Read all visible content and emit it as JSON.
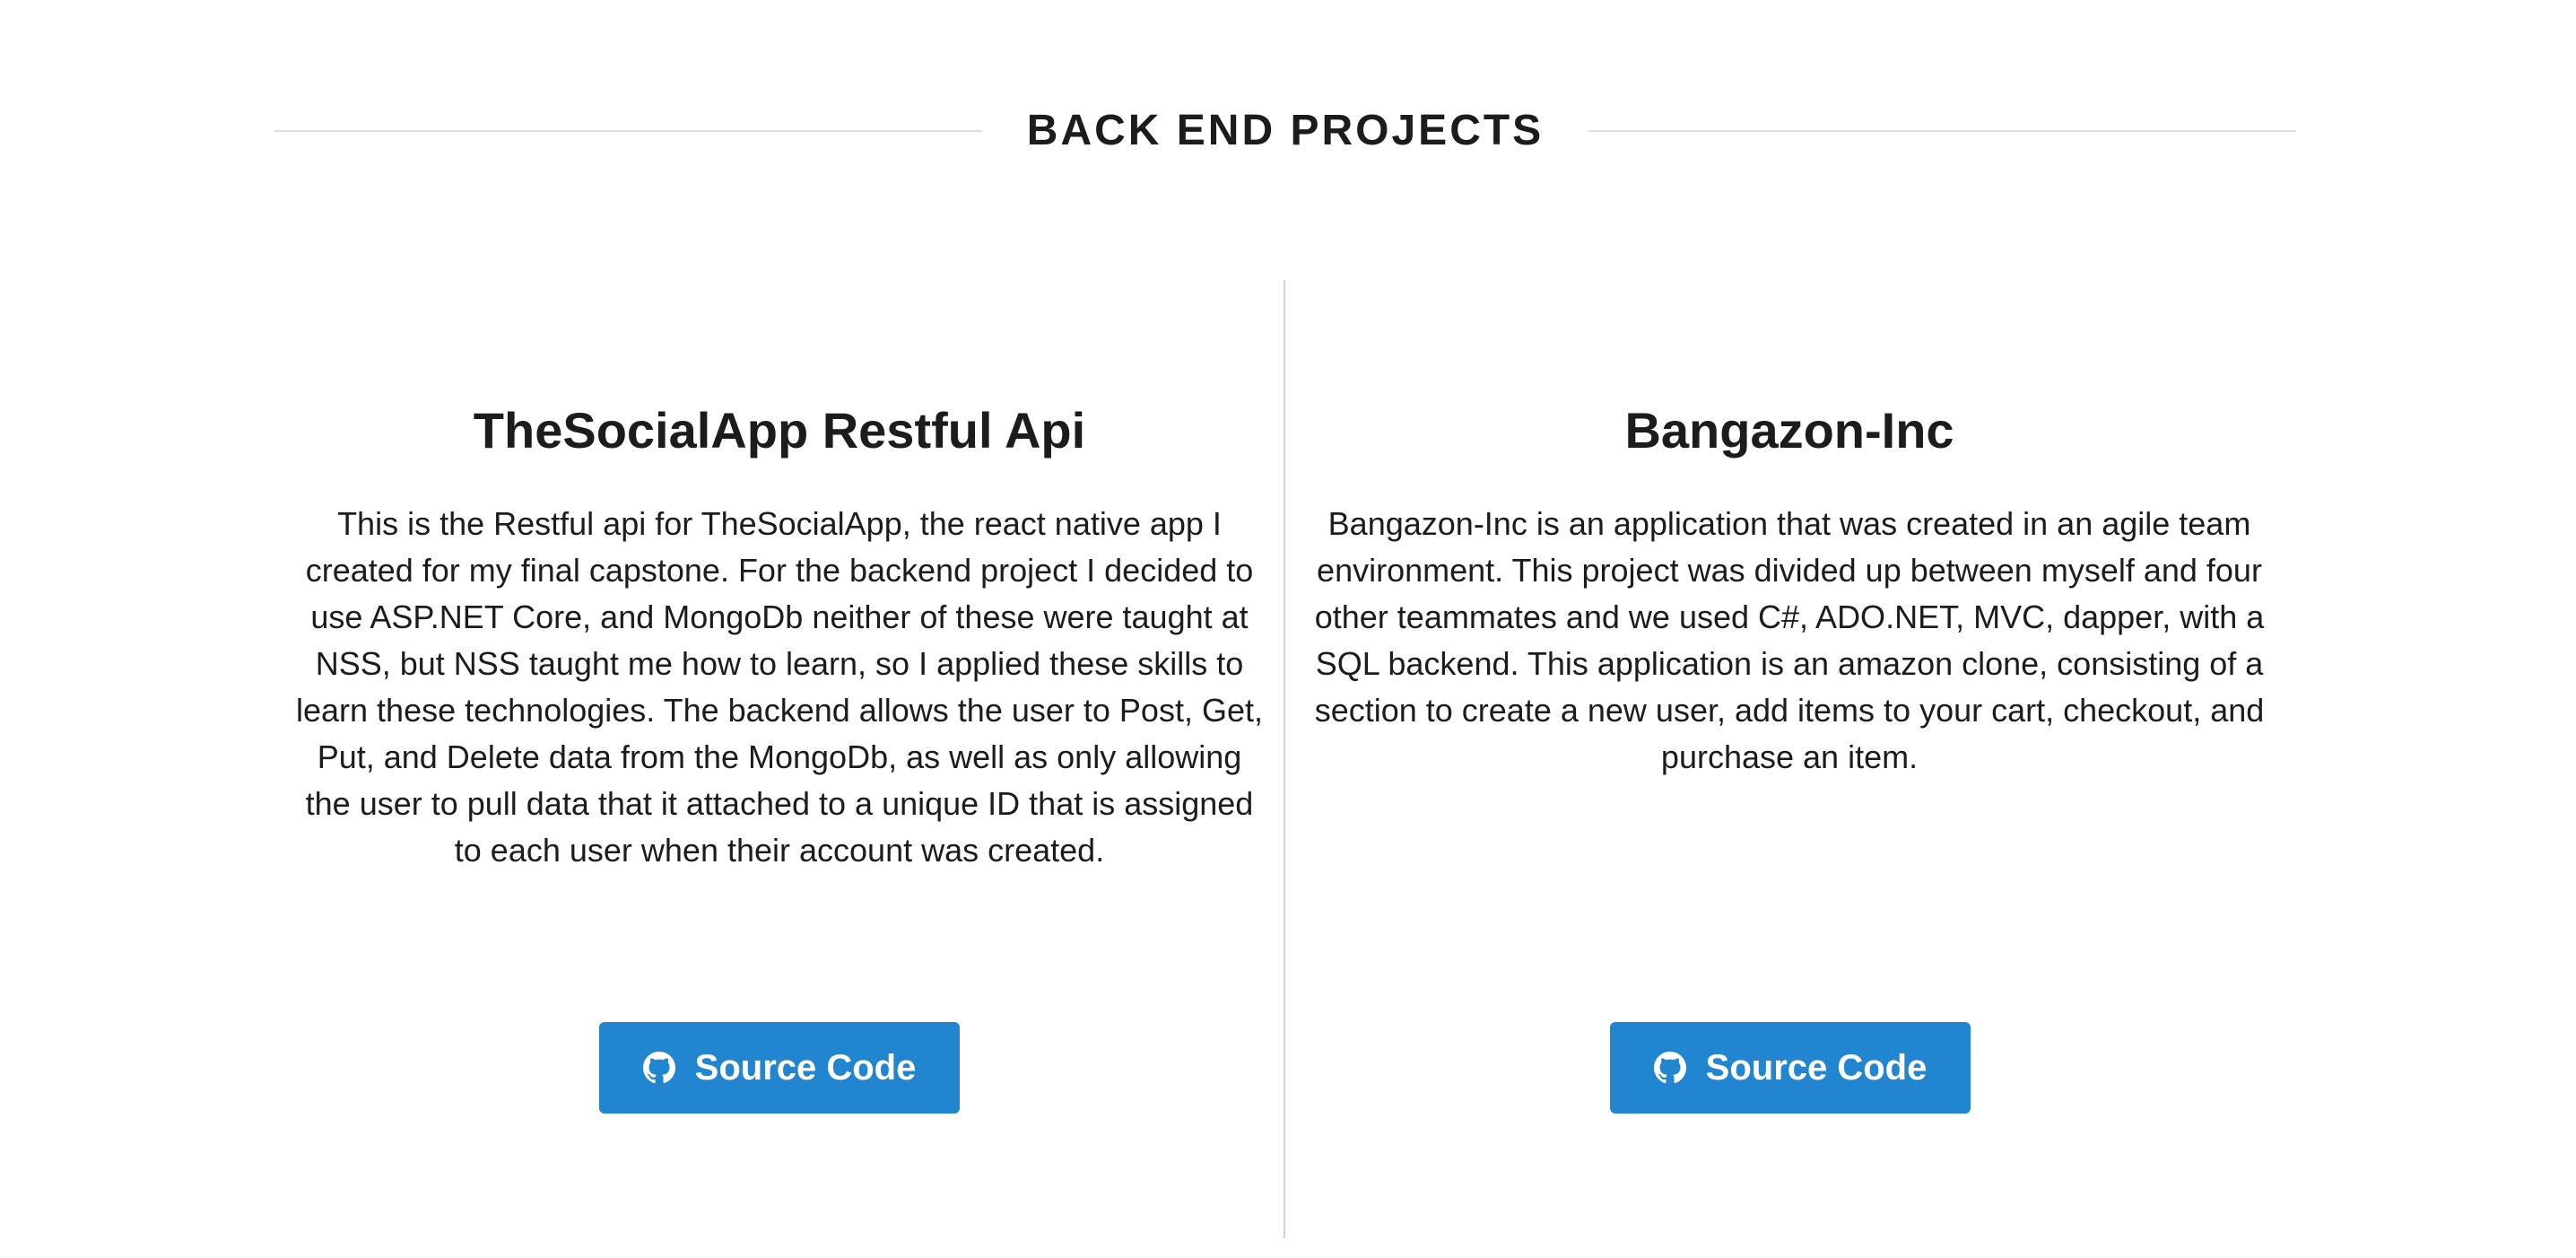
{
  "section": {
    "title": "BACK END PROJECTS"
  },
  "projects": [
    {
      "title": "TheSocialApp Restful Api",
      "description": "This is the Restful api for TheSocialApp, the react native app I created for my final capstone. For the backend project I decided to use ASP.NET Core, and MongoDb neither of these were taught at NSS, but NSS taught me how to learn, so I applied these skills to learn these technologies. The backend allows the user to Post, Get, Put, and Delete data from the MongoDb, as well as only allowing the user to pull data that it attached to a unique ID that is assigned to each user when their account was created.",
      "button_label": "Source Code",
      "button_icon": "github-icon"
    },
    {
      "title": "Bangazon-Inc",
      "description": "Bangazon-Inc is an application that was created in an agile team environment. This project was divided up between myself and four other teammates and we used C#, ADO.NET, MVC, dapper, with a SQL backend. This application is an amazon clone, consisting of a section to create a new user, add items to your cart, checkout, and purchase an item.",
      "button_label": "Source Code",
      "button_icon": "github-icon"
    }
  ],
  "colors": {
    "button_bg": "#2185d0",
    "text": "#1b1c1d",
    "rule": "#dedede"
  }
}
